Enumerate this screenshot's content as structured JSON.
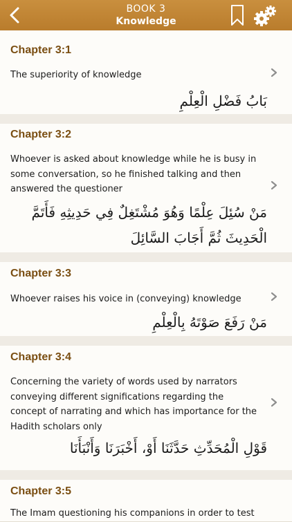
{
  "nav": {
    "book": "BOOK 3",
    "title": "Knowledge",
    "icons": {
      "back": "chevron-left-icon",
      "bookmark": "bookmark-icon",
      "settings": "gears-icon"
    }
  },
  "colors": {
    "navbar": "#bf8434",
    "chapter_title": "#7a4e12",
    "card_bg": "#fdfcf9",
    "page_bg": "#efebe4"
  },
  "chapters": [
    {
      "title": "Chapter 3:1",
      "description": "The superiority of knowledge",
      "arabic": "بَابُ فَضْلِ الْعِلْمِ"
    },
    {
      "title": "Chapter 3:2",
      "description": "Whoever is asked about knowledge while he is busy in some conversation, so he finished talking and then answered the questioner",
      "arabic": "مَنْ سُئِلَ عِلْمًا وَهُوَ مُشْتَغِلٌ فِي حَدِيثِهِ فَأَتَمَّ الْحَدِيثَ ثُمَّ أَجَابَ السَّائِلَ"
    },
    {
      "title": "Chapter 3:3",
      "description": "Whoever raises his voice in (conveying) knowledge",
      "arabic": "مَنْ رَفَعَ صَوْتَهُ بِالْعِلْمِ"
    },
    {
      "title": "Chapter 3:4",
      "description": "Concerning the variety of words used by narrators conveying different significations regarding the concept of narrating and which has importance for the Hadith scholars only",
      "arabic": "قَوْلِ الْمُحَدِّثِ حَدَّثَنَا أَوْ، أَخْبَرَنَا وَأَنْبَأَنَا"
    },
    {
      "title": "Chapter 3:5",
      "description": "The Imam questioning his companions in order to test"
    }
  ]
}
